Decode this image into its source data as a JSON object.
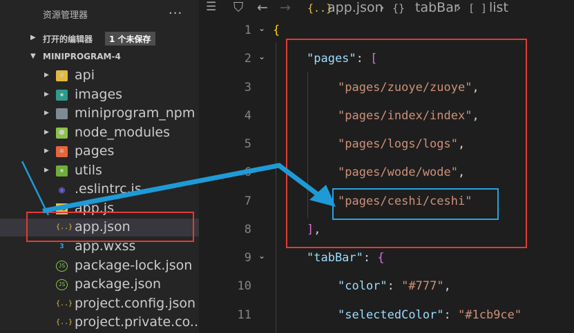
{
  "sidebar": {
    "title": "资源管理器",
    "more_icon": "...",
    "open_editors": {
      "label": "打开的编辑器",
      "badge": "1 个未保存"
    },
    "project": {
      "label": "MINIPROGRAM-4"
    },
    "items": [
      {
        "label": "api",
        "icon": "folder-api-icon",
        "glyph": "#",
        "expandable": true
      },
      {
        "label": "images",
        "icon": "folder-images-icon",
        "glyph": "▪",
        "expandable": true
      },
      {
        "label": "miniprogram_npm",
        "icon": "folder-icon",
        "glyph": "",
        "expandable": true
      },
      {
        "label": "node_modules",
        "icon": "folder-node-icon",
        "glyph": "⬢",
        "expandable": true
      },
      {
        "label": "pages",
        "icon": "folder-pages-icon",
        "glyph": "≡",
        "expandable": true
      },
      {
        "label": "utils",
        "icon": "folder-utils-icon",
        "glyph": "▪",
        "expandable": true
      },
      {
        "label": ".eslintrc.js",
        "icon": "eslint-icon",
        "glyph": "◉",
        "expandable": false
      },
      {
        "label": "app.js",
        "icon": "js-file-icon",
        "glyph": "JS",
        "expandable": false
      },
      {
        "label": "app.json",
        "icon": "json-file-icon",
        "glyph": "{..}",
        "expandable": false
      },
      {
        "label": "app.wxss",
        "icon": "css-file-icon",
        "glyph": "3",
        "expandable": false
      },
      {
        "label": "package-lock.json",
        "icon": "node-json-icon",
        "glyph": "JS",
        "expandable": false
      },
      {
        "label": "package.json",
        "icon": "node-json-icon",
        "glyph": "JS",
        "expandable": false
      },
      {
        "label": "project.config.json",
        "icon": "json-file-icon",
        "glyph": "{..}",
        "expandable": false
      },
      {
        "label": "project.private.co...",
        "icon": "json-file-icon",
        "glyph": "{..}",
        "expandable": false
      }
    ],
    "active_item": "app.json"
  },
  "editor": {
    "breadcrumb": {
      "list_view_icon": "☰",
      "bookmark_icon": "⛉",
      "back_icon": "←",
      "forward_icon": "→",
      "json_icon": "{..}",
      "file": "app.json",
      "sep": "›",
      "obj_icon": "{}",
      "tabbar": "tabBar",
      "arr_icon": "[ ]",
      "list": "list"
    },
    "lines": [
      {
        "num": "1",
        "fold": "⌄"
      },
      {
        "num": "2",
        "fold": "⌄"
      },
      {
        "num": "3"
      },
      {
        "num": "4"
      },
      {
        "num": "5"
      },
      {
        "num": "6"
      },
      {
        "num": "7"
      },
      {
        "num": "8"
      },
      {
        "num": "9",
        "fold": "⌄"
      },
      {
        "num": "10"
      },
      {
        "num": "11"
      }
    ],
    "code": {
      "l1_brace": "{",
      "l2_key": "\"pages\"",
      "l2_colon": ": ",
      "l2_bracket": "[",
      "l3": "\"pages/zuoye/zuoye\"",
      "l4": "\"pages/index/index\"",
      "l5": "\"pages/logs/logs\"",
      "l6": "\"pages/wode/wode\"",
      "l7": "\"pages/ceshi/ceshi\"",
      "comma": ",",
      "l8_bracket": "]",
      "l9_key": "\"tabBar\"",
      "l9_brace": "{",
      "l10_key": "\"color\"",
      "l10_val": "\"#777\"",
      "l11_key": "\"selectedColor\"",
      "l11_val": "\"#1cb9ce\""
    }
  },
  "colors": {
    "highlight_red": "#e53935",
    "highlight_blue": "#29a3e0",
    "arrow": "#1e9bd7"
  }
}
